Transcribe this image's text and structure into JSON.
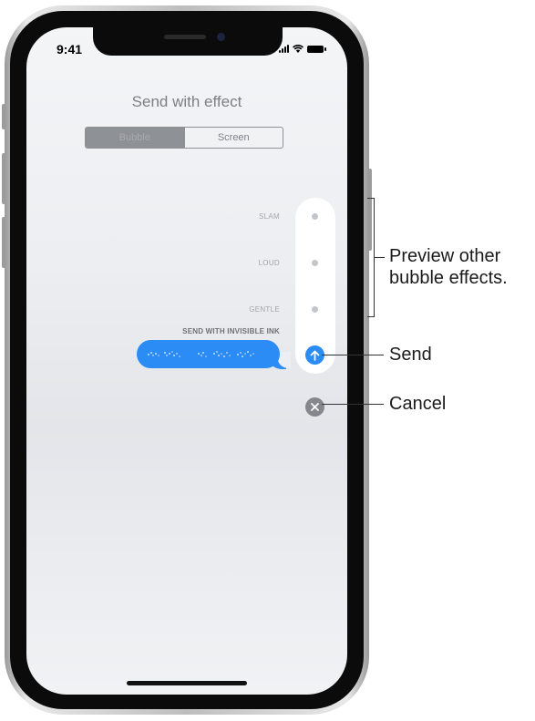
{
  "status_bar": {
    "time": "9:41",
    "icons": [
      "signal-icon",
      "wifi-icon",
      "battery-icon"
    ]
  },
  "screen": {
    "title": "Send with effect",
    "segments": [
      {
        "label": "Bubble",
        "selected": true
      },
      {
        "label": "Screen",
        "selected": false
      }
    ],
    "effects": [
      {
        "label": "SLAM"
      },
      {
        "label": "LOUD"
      },
      {
        "label": "GENTLE"
      }
    ],
    "selected_effect_label": "SEND WITH INVISIBLE INK",
    "send_icon": "arrow-up-icon",
    "cancel_icon": "close-icon"
  },
  "callouts": {
    "preview": "Preview other bubble effects.",
    "preview_line1": "Preview other",
    "preview_line2": "bubble effects.",
    "send": "Send",
    "cancel": "Cancel"
  },
  "colors": {
    "accent": "#2a8cf4",
    "cancel": "#85878c"
  }
}
